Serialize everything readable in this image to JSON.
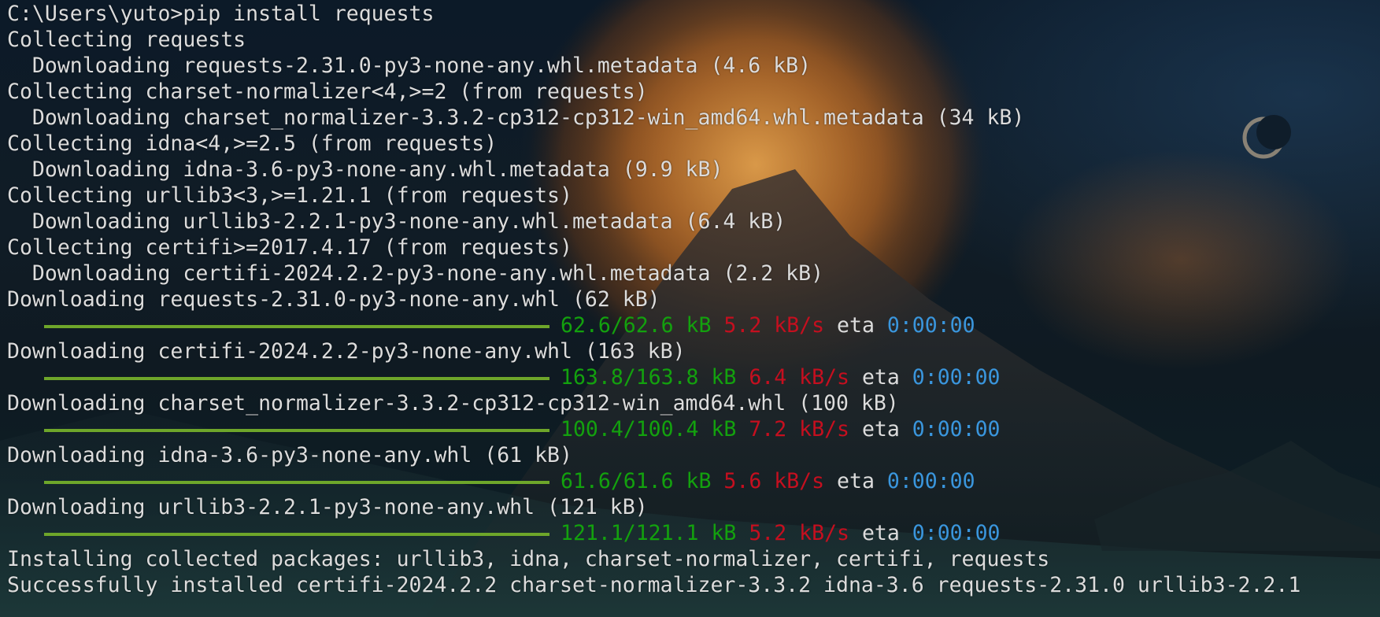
{
  "colors": {
    "text": "#dcdcdc",
    "progress_bar": "#6ea62a",
    "size": "#13a10e",
    "speed": "#c50f1f",
    "eta": "#3a96dd"
  },
  "lines": [
    "C:\\Users\\yuto>pip install requests",
    "Collecting requests",
    "  Downloading requests-2.31.0-py3-none-any.whl.metadata (4.6 kB)",
    "Collecting charset-normalizer<4,>=2 (from requests)",
    "  Downloading charset_normalizer-3.3.2-cp312-cp312-win_amd64.whl.metadata (34 kB)",
    "Collecting idna<4,>=2.5 (from requests)",
    "  Downloading idna-3.6-py3-none-any.whl.metadata (9.9 kB)",
    "Collecting urllib3<3,>=1.21.1 (from requests)",
    "  Downloading urllib3-2.2.1-py3-none-any.whl.metadata (6.4 kB)",
    "Collecting certifi>=2017.4.17 (from requests)",
    "  Downloading certifi-2024.2.2-py3-none-any.whl.metadata (2.2 kB)"
  ],
  "downloads": [
    {
      "label": "Downloading requests-2.31.0-py3-none-any.whl (62 kB)",
      "size": "62.6/62.6 kB",
      "speed": "5.2 kB/s",
      "eta_label": "eta",
      "eta": "0:00:00",
      "progress": 1.0
    },
    {
      "label": "Downloading certifi-2024.2.2-py3-none-any.whl (163 kB)",
      "size": "163.8/163.8 kB",
      "speed": "6.4 kB/s",
      "eta_label": "eta",
      "eta": "0:00:00",
      "progress": 1.0
    },
    {
      "label": "Downloading charset_normalizer-3.3.2-cp312-cp312-win_amd64.whl (100 kB)",
      "size": "100.4/100.4 kB",
      "speed": "7.2 kB/s",
      "eta_label": "eta",
      "eta": "0:00:00",
      "progress": 1.0
    },
    {
      "label": "Downloading idna-3.6-py3-none-any.whl (61 kB)",
      "size": "61.6/61.6 kB",
      "speed": "5.6 kB/s",
      "eta_label": "eta",
      "eta": "0:00:00",
      "progress": 1.0
    },
    {
      "label": "Downloading urllib3-2.2.1-py3-none-any.whl (121 kB)",
      "size": "121.1/121.1 kB",
      "speed": "5.2 kB/s",
      "eta_label": "eta",
      "eta": "0:00:00",
      "progress": 1.0
    }
  ],
  "final_lines": [
    "Installing collected packages: urllib3, idna, charset-normalizer, certifi, requests",
    "Successfully installed certifi-2024.2.2 charset-normalizer-3.3.2 idna-3.6 requests-2.31.0 urllib3-2.2.1"
  ]
}
